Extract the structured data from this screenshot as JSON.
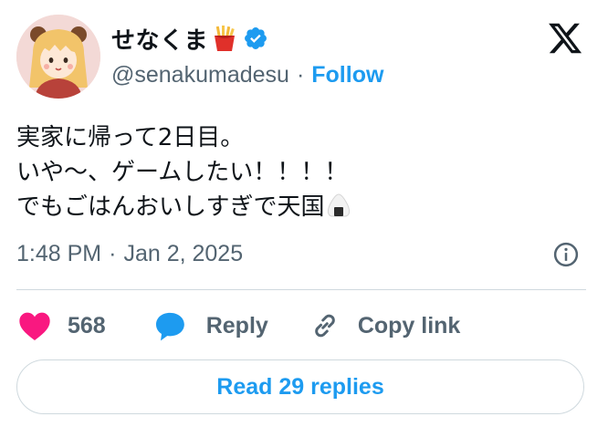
{
  "user": {
    "display_name": "せなくま",
    "name_emoji": "fries-emoji",
    "verified": true,
    "handle": "@senakumadesu",
    "separator": "·",
    "follow_label": "Follow"
  },
  "tweet": {
    "lines": [
      "実家に帰って2日目。",
      "いや〜、ゲームしたい！！！！",
      "でもごはんおいしすぎで天国"
    ],
    "trailing_emoji": "onigiri-emoji"
  },
  "meta": {
    "time": "1:48 PM",
    "separator": "·",
    "date": "Jan 2, 2025"
  },
  "actions": {
    "like_count": "568",
    "reply_label": "Reply",
    "copy_link_label": "Copy link"
  },
  "read_replies_label": "Read 29 replies",
  "colors": {
    "accent": "#1d9bf0",
    "like": "#f91880",
    "secondary_text": "#536471",
    "border": "#cfd9de"
  }
}
